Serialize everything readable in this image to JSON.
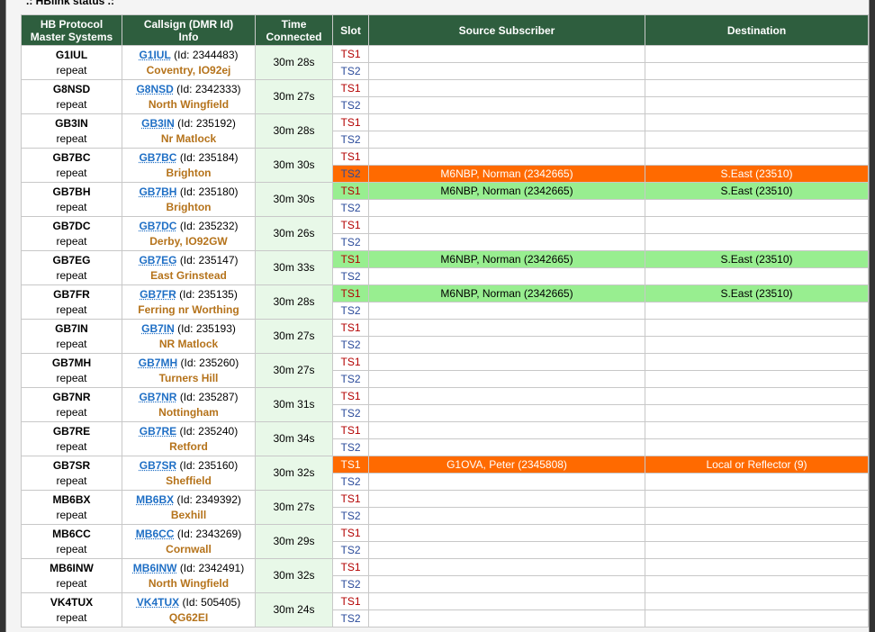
{
  "title": ".: HBlink status .:",
  "headers": {
    "system": [
      "HB Protocol",
      "Master Systems"
    ],
    "info": [
      "Callsign (DMR Id)",
      "Info"
    ],
    "time": [
      "Time",
      "Connected"
    ],
    "slot": "Slot",
    "source": "Source Subscriber",
    "destination": "Destination"
  },
  "rows": [
    {
      "name": "G1IUL",
      "mode": "repeat",
      "callsign": "G1IUL",
      "id": "(Id: 2344483)",
      "location": "Coventry, IO92ej",
      "time": "30m 28s",
      "ts1": {
        "label": "TS1",
        "src": "",
        "dst": "",
        "state": ""
      },
      "ts2": {
        "label": "TS2",
        "src": "",
        "dst": "",
        "state": ""
      }
    },
    {
      "name": "G8NSD",
      "mode": "repeat",
      "callsign": "G8NSD",
      "id": "(Id: 2342333)",
      "location": "North Wingfield",
      "time": "30m 27s",
      "ts1": {
        "label": "TS1",
        "src": "",
        "dst": "",
        "state": ""
      },
      "ts2": {
        "label": "TS2",
        "src": "",
        "dst": "",
        "state": ""
      }
    },
    {
      "name": "GB3IN",
      "mode": "repeat",
      "callsign": "GB3IN",
      "id": "(Id: 235192)",
      "location": "Nr Matlock",
      "time": "30m 28s",
      "ts1": {
        "label": "TS1",
        "src": "",
        "dst": "",
        "state": ""
      },
      "ts2": {
        "label": "TS2",
        "src": "",
        "dst": "",
        "state": ""
      }
    },
    {
      "name": "GB7BC",
      "mode": "repeat",
      "callsign": "GB7BC",
      "id": "(Id: 235184)",
      "location": "Brighton",
      "time": "30m 30s",
      "ts1": {
        "label": "TS1",
        "src": "",
        "dst": "",
        "state": ""
      },
      "ts2": {
        "label": "TS2",
        "src": "M6NBP, Norman (2342665)",
        "dst": "S.East (23510)",
        "state": "orange"
      }
    },
    {
      "name": "GB7BH",
      "mode": "repeat",
      "callsign": "GB7BH",
      "id": "(Id: 235180)",
      "location": "Brighton",
      "time": "30m 30s",
      "ts1": {
        "label": "TS1",
        "src": "M6NBP, Norman (2342665)",
        "dst": "S.East (23510)",
        "state": "green"
      },
      "ts2": {
        "label": "TS2",
        "src": "",
        "dst": "",
        "state": ""
      }
    },
    {
      "name": "GB7DC",
      "mode": "repeat",
      "callsign": "GB7DC",
      "id": "(Id: 235232)",
      "location": "Derby, IO92GW",
      "time": "30m 26s",
      "ts1": {
        "label": "TS1",
        "src": "",
        "dst": "",
        "state": ""
      },
      "ts2": {
        "label": "TS2",
        "src": "",
        "dst": "",
        "state": ""
      }
    },
    {
      "name": "GB7EG",
      "mode": "repeat",
      "callsign": "GB7EG",
      "id": "(Id: 235147)",
      "location": "East Grinstead",
      "time": "30m 33s",
      "ts1": {
        "label": "TS1",
        "src": "M6NBP, Norman (2342665)",
        "dst": "S.East (23510)",
        "state": "green"
      },
      "ts2": {
        "label": "TS2",
        "src": "",
        "dst": "",
        "state": ""
      }
    },
    {
      "name": "GB7FR",
      "mode": "repeat",
      "callsign": "GB7FR",
      "id": "(Id: 235135)",
      "location": "Ferring nr Worthing",
      "time": "30m 28s",
      "ts1": {
        "label": "TS1",
        "src": "M6NBP, Norman (2342665)",
        "dst": "S.East (23510)",
        "state": "green"
      },
      "ts2": {
        "label": "TS2",
        "src": "",
        "dst": "",
        "state": ""
      }
    },
    {
      "name": "GB7IN",
      "mode": "repeat",
      "callsign": "GB7IN",
      "id": "(Id: 235193)",
      "location": "NR Matlock",
      "time": "30m 27s",
      "ts1": {
        "label": "TS1",
        "src": "",
        "dst": "",
        "state": ""
      },
      "ts2": {
        "label": "TS2",
        "src": "",
        "dst": "",
        "state": ""
      }
    },
    {
      "name": "GB7MH",
      "mode": "repeat",
      "callsign": "GB7MH",
      "id": "(Id: 235260)",
      "location": "Turners Hill",
      "time": "30m 27s",
      "ts1": {
        "label": "TS1",
        "src": "",
        "dst": "",
        "state": ""
      },
      "ts2": {
        "label": "TS2",
        "src": "",
        "dst": "",
        "state": ""
      }
    },
    {
      "name": "GB7NR",
      "mode": "repeat",
      "callsign": "GB7NR",
      "id": "(Id: 235287)",
      "location": "Nottingham",
      "time": "30m 31s",
      "ts1": {
        "label": "TS1",
        "src": "",
        "dst": "",
        "state": ""
      },
      "ts2": {
        "label": "TS2",
        "src": "",
        "dst": "",
        "state": ""
      }
    },
    {
      "name": "GB7RE",
      "mode": "repeat",
      "callsign": "GB7RE",
      "id": "(Id: 235240)",
      "location": "Retford",
      "time": "30m 34s",
      "ts1": {
        "label": "TS1",
        "src": "",
        "dst": "",
        "state": ""
      },
      "ts2": {
        "label": "TS2",
        "src": "",
        "dst": "",
        "state": ""
      }
    },
    {
      "name": "GB7SR",
      "mode": "repeat",
      "callsign": "GB7SR",
      "id": "(Id: 235160)",
      "location": "Sheffield",
      "time": "30m 32s",
      "ts1": {
        "label": "TS1",
        "src": "G1OVA, Peter (2345808)",
        "dst": "Local or Reflector (9)",
        "state": "orange"
      },
      "ts2": {
        "label": "TS2",
        "src": "",
        "dst": "",
        "state": ""
      }
    },
    {
      "name": "MB6BX",
      "mode": "repeat",
      "callsign": "MB6BX",
      "id": "(Id: 2349392)",
      "location": "Bexhill",
      "time": "30m 27s",
      "ts1": {
        "label": "TS1",
        "src": "",
        "dst": "",
        "state": ""
      },
      "ts2": {
        "label": "TS2",
        "src": "",
        "dst": "",
        "state": ""
      }
    },
    {
      "name": "MB6CC",
      "mode": "repeat",
      "callsign": "MB6CC",
      "id": "(Id: 2343269)",
      "location": "Cornwall",
      "time": "30m 29s",
      "ts1": {
        "label": "TS1",
        "src": "",
        "dst": "",
        "state": ""
      },
      "ts2": {
        "label": "TS2",
        "src": "",
        "dst": "",
        "state": ""
      }
    },
    {
      "name": "MB6INW",
      "mode": "repeat",
      "callsign": "MB6INW",
      "id": "(Id: 2342491)",
      "location": "North Wingfield",
      "time": "30m 32s",
      "ts1": {
        "label": "TS1",
        "src": "",
        "dst": "",
        "state": ""
      },
      "ts2": {
        "label": "TS2",
        "src": "",
        "dst": "",
        "state": ""
      }
    },
    {
      "name": "VK4TUX",
      "mode": "repeat",
      "callsign": "VK4TUX",
      "id": "(Id: 505405)",
      "location": "QG62EI",
      "time": "30m 24s",
      "ts1": {
        "label": "TS1",
        "src": "",
        "dst": "",
        "state": ""
      },
      "ts2": {
        "label": "TS2",
        "src": "",
        "dst": "",
        "state": ""
      }
    }
  ],
  "colors": {
    "header": "#2e5e3e",
    "active_orange": "#ff6a00",
    "active_green": "#98ee90",
    "callsign": "#1f6fc5",
    "location": "#b5731b"
  }
}
